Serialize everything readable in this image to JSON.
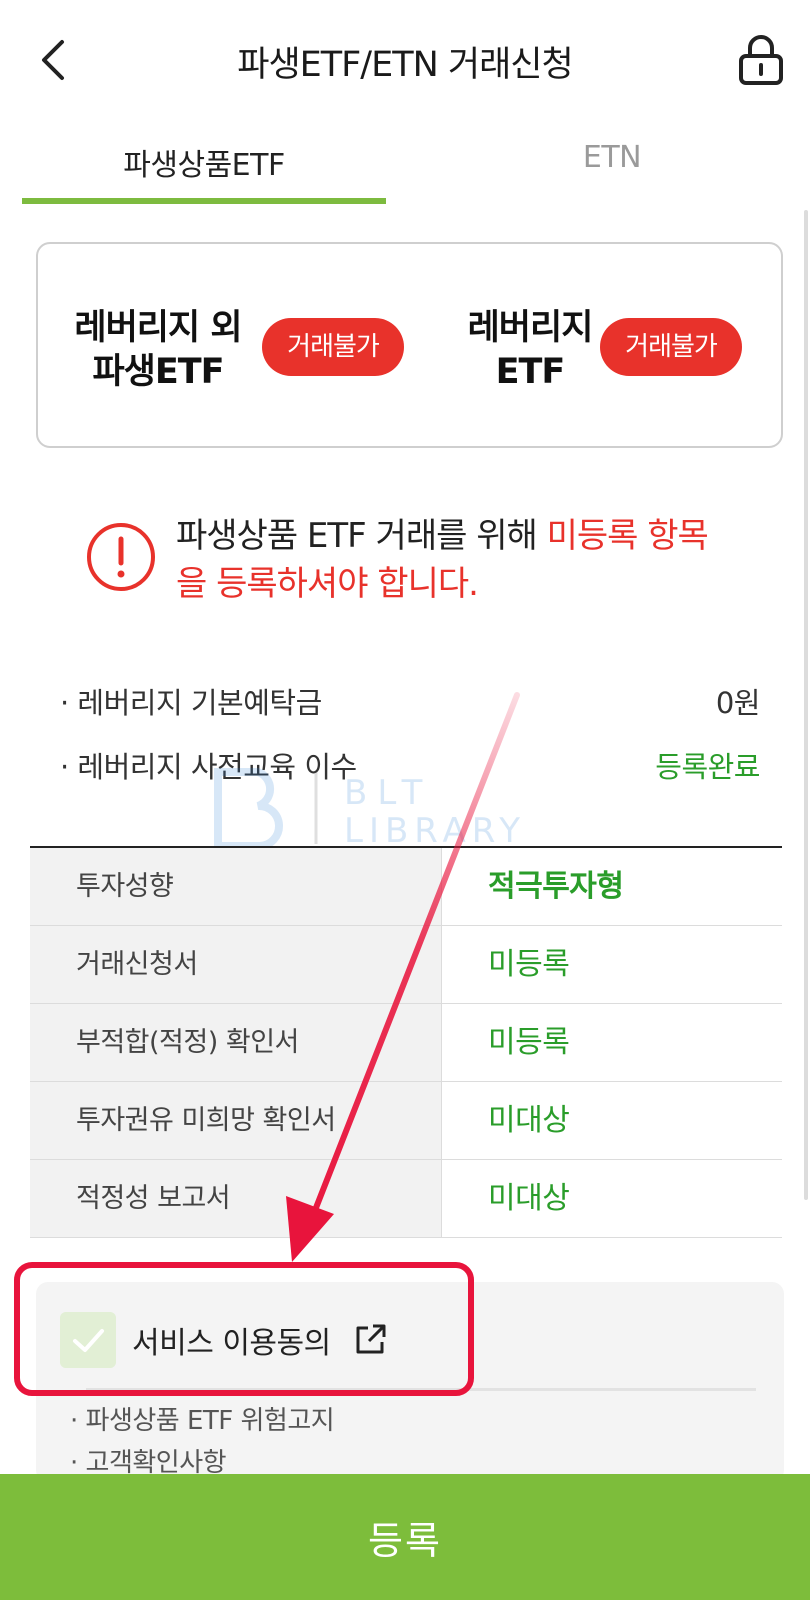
{
  "header": {
    "title": "파생ETF/ETN 거래신청"
  },
  "tabs": [
    {
      "label": "파생상품ETF",
      "active": true
    },
    {
      "label": "ETN",
      "active": false
    }
  ],
  "status_card": {
    "item1_label_line1": "레버리지 외",
    "item1_label_line2": "파생ETF",
    "item1_badge": "거래불가",
    "item2_label_line1": "레버리지",
    "item2_label_line2": "ETF",
    "item2_badge": "거래불가"
  },
  "notice": {
    "text_normal": "파생상품 ETF 거래를 위해 ",
    "text_highlight": "미등록 항목을 등록하셔야 합니다."
  },
  "info": [
    {
      "label": "· 레버리지 기본예탁금",
      "value": "0원"
    },
    {
      "label": "· 레버리지 사전교육 이수",
      "value": "등록완료"
    }
  ],
  "watermark": {
    "line1": "BLT",
    "line2": "LIBRARY"
  },
  "table": [
    {
      "label": "투자성향",
      "value": "적극투자형"
    },
    {
      "label": "거래신청서",
      "value": "미등록"
    },
    {
      "label": "부적합(적정) 확인서",
      "value": "미등록"
    },
    {
      "label": "투자권유 미희망 확인서",
      "value": "미대상"
    },
    {
      "label": "적정성 보고서",
      "value": "미대상"
    }
  ],
  "agreement": {
    "label": "서비스 이용동의",
    "items": [
      "· 파생상품 ETF 위험고지",
      "· 고객확인사항"
    ]
  },
  "submit_label": "등록",
  "colors": {
    "accent_green": "#7dbd3b",
    "status_green": "#2a9d2a",
    "warning_red": "#e8322b",
    "highlight_red": "#e8143c"
  }
}
